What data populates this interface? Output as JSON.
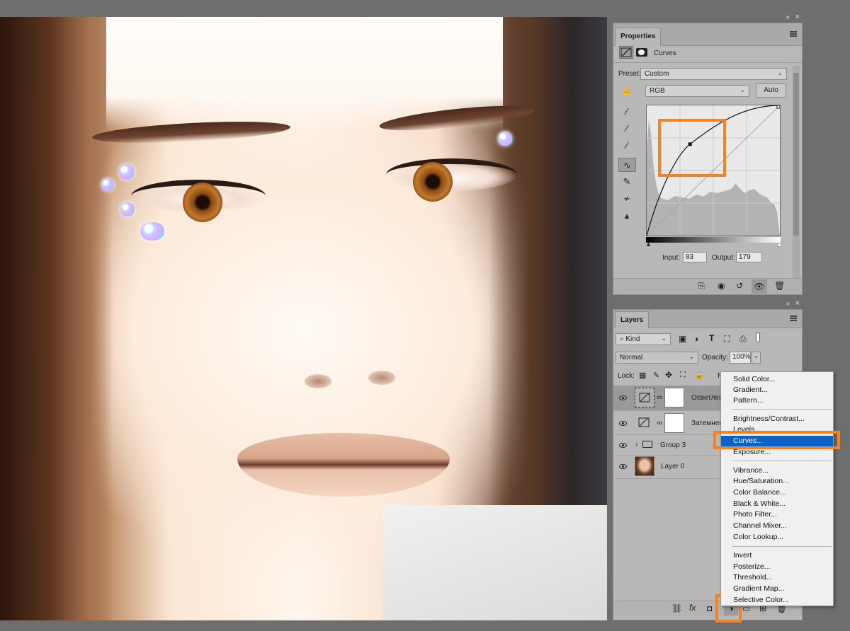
{
  "properties": {
    "tab_label": "Properties",
    "adjustment_name": "Curves",
    "preset_label": "Preset:",
    "preset_value": "Custom",
    "channel_value": "RGB",
    "auto_label": "Auto",
    "input_label": "Input:",
    "input_value": "83",
    "output_label": "Output:",
    "output_value": "179",
    "curve_point": {
      "input": 83,
      "output": 179
    }
  },
  "layers": {
    "tab_label": "Layers",
    "filter_kind": "Kind",
    "blend_mode": "Normal",
    "opacity_label": "Opacity:",
    "opacity_value": "100%",
    "lock_label": "Lock:",
    "fill_label": "F",
    "rows": [
      {
        "name": "Осветлен"
      },
      {
        "name": "Затемнен"
      },
      {
        "name": "Group 3"
      },
      {
        "name": "Layer 0"
      }
    ]
  },
  "adjustment_menu": {
    "groups": [
      [
        "Solid Color...",
        "Gradient...",
        "Pattern..."
      ],
      [
        "Brightness/Contrast...",
        "Levels...",
        "Curves...",
        "Exposure..."
      ],
      [
        "Vibrance...",
        "Hue/Saturation...",
        "Color Balance...",
        "Black & White...",
        "Photo Filter...",
        "Channel Mixer...",
        "Color Lookup..."
      ],
      [
        "Invert",
        "Posterize...",
        "Threshold...",
        "Gradient Map...",
        "Selective Color..."
      ]
    ],
    "selected": "Curves..."
  },
  "colors": {
    "highlight": "#f58220",
    "menu_selection": "#0a62c4",
    "panel_bg": "#b8b8b8"
  },
  "icons": {
    "panel_collapse": "double-chevron-icon",
    "panel_close": "close-icon",
    "panel_menu": "hamburger-icon"
  }
}
